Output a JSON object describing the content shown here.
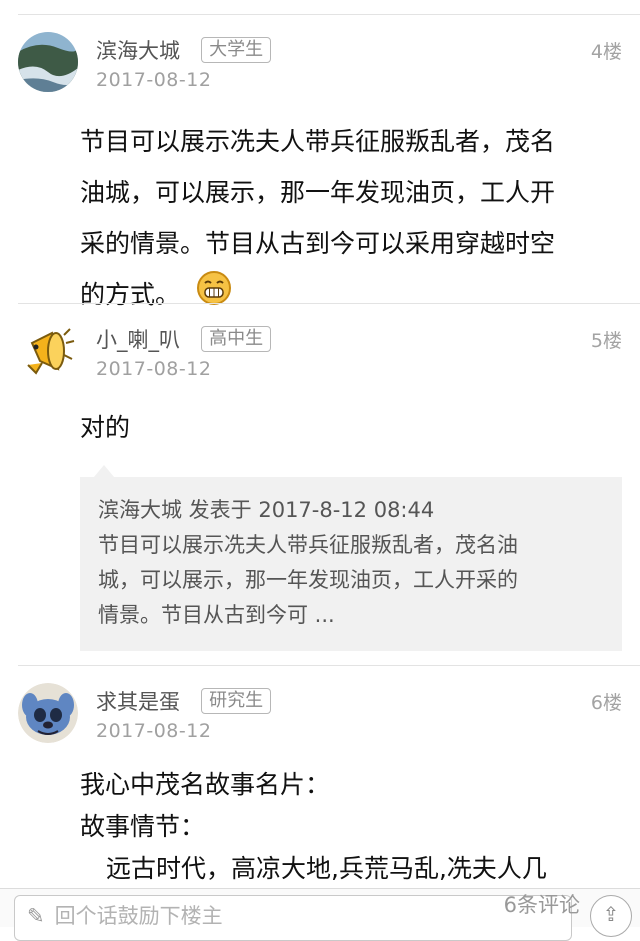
{
  "posts": [
    {
      "username": "滨海大城",
      "badge": "大学生",
      "date": "2017-08-12",
      "floor": "4楼",
      "content": [
        "节目可以展示冼夫人带兵征服叛乱者，茂名",
        "油城，可以展示，那一年发现油页，工人开",
        "采的情景。节目从古到今可以采用穿越时空",
        "的方式。"
      ]
    },
    {
      "username": "小_喇_叭",
      "badge": "高中生",
      "date": "2017-08-12",
      "floor": "5楼",
      "content": [
        "对的"
      ],
      "quote": {
        "header": "滨海大城 发表于 2017-8-12 08:44",
        "lines": [
          "节目可以展示冼夫人带兵征服叛乱者，茂名油",
          "城，可以展示，那一年发现油页，工人开采的",
          "情景。节目从古到今可 ..."
        ]
      }
    },
    {
      "username": "求其是蛋",
      "badge": "研究生",
      "date": "2017-08-12",
      "floor": "6楼",
      "content": [
        "我心中茂名故事名片：",
        "故事情节：",
        "远古时代，高凉大地,兵荒马乱,冼夫人几"
      ]
    }
  ],
  "bottom_bar": {
    "input_placeholder": "回个话鼓励下楼主",
    "comments": "6条评论",
    "icons": [
      "pencil-icon",
      "share-icon"
    ]
  }
}
